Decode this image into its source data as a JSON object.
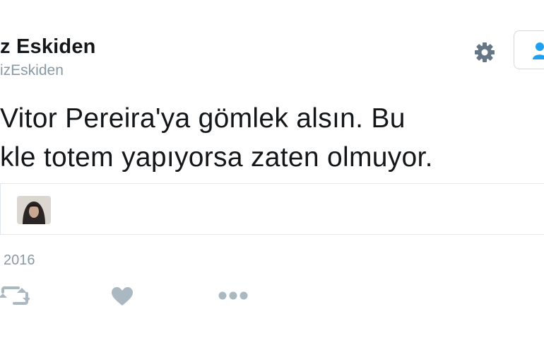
{
  "profile": {
    "display_name": "z Eskiden",
    "handle": "izEskiden"
  },
  "tweet": {
    "lines": [
      "Vitor Pereira'ya gömlek alsın. Bu",
      "kle totem yapıyorsa zaten olmuyor."
    ],
    "timestamp": "2016"
  },
  "icons": {
    "settings": "gear-icon",
    "follow": "add-user-icon",
    "retweet": "retweet-icon",
    "like": "heart-icon",
    "more": "more-icon"
  },
  "colors": {
    "text": "#14171a",
    "muted": "#8899a6",
    "accent": "#1da1f2",
    "border": "#e1e8ed"
  }
}
